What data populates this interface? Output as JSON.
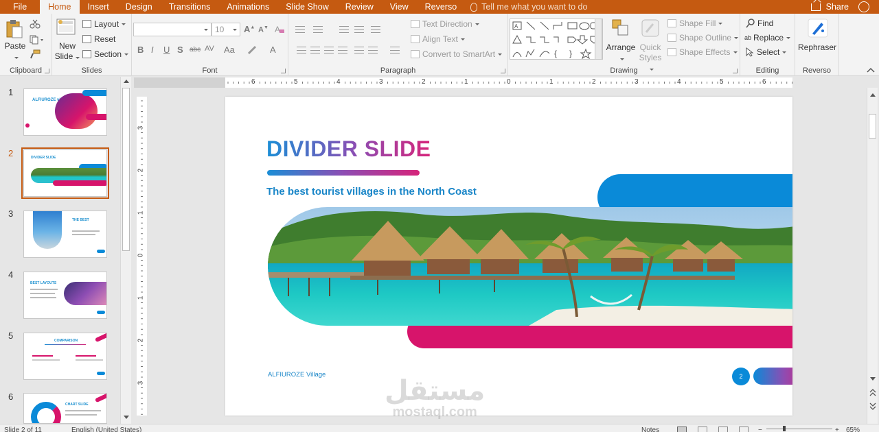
{
  "tabs": [
    "File",
    "Home",
    "Insert",
    "Design",
    "Transitions",
    "Animations",
    "Slide Show",
    "Review",
    "View",
    "Reverso"
  ],
  "active_tab": "Home",
  "tell_me": "Tell me what you want to do",
  "share": "Share",
  "ribbon": {
    "clipboard": {
      "paste": "Paste",
      "label": "Clipboard"
    },
    "slides": {
      "new_slide": "New Slide",
      "layout": "Layout",
      "reset": "Reset",
      "section": "Section",
      "label": "Slides"
    },
    "font": {
      "font_size": "10",
      "label": "Font"
    },
    "paragraph": {
      "text_direction": "Text Direction",
      "align_text": "Align Text",
      "convert_smartart": "Convert to SmartArt",
      "label": "Paragraph"
    },
    "drawing": {
      "arrange": "Arrange",
      "quick_styles": "Quick Styles",
      "shape_fill": "Shape Fill",
      "shape_outline": "Shape Outline",
      "shape_effects": "Shape Effects",
      "label": "Drawing"
    },
    "editing": {
      "find": "Find",
      "replace": "Replace",
      "select": "Select",
      "label": "Editing"
    },
    "reverso": {
      "rephraser": "Rephraser",
      "label": "Reverso"
    }
  },
  "thumbnails": [
    {
      "num": "1",
      "title": "ALFIUROZE village"
    },
    {
      "num": "2",
      "title": "DIVIDER SLIDE"
    },
    {
      "num": "3",
      "title": "THE BEST"
    },
    {
      "num": "4",
      "title": "BEST LAYOUTS"
    },
    {
      "num": "5",
      "title": "COMPARISON"
    },
    {
      "num": "6",
      "title": "CHART SLIDE"
    }
  ],
  "active_slide": "2",
  "hruler_labels": [
    "6",
    "5",
    "4",
    "3",
    "2",
    "1",
    "0",
    "1",
    "2",
    "3",
    "4",
    "5",
    "6"
  ],
  "vruler_labels": [
    "3",
    "2",
    "1",
    "0",
    "1",
    "2",
    "3"
  ],
  "slide": {
    "title": "DIVIDER SLIDE",
    "subtitle": "The best tourist villages in the North Coast",
    "footer": "ALFIUROZE Village",
    "page_number": "2"
  },
  "watermark": {
    "arabic": "مستقل",
    "latin": "mostaql.com"
  },
  "status": {
    "slide_info": "Slide 2 of 11",
    "language": "English (United States)",
    "notes": "Notes",
    "zoom": "65%"
  },
  "colors": {
    "accent": "#c55a11",
    "slide_blue": "#0a8ad8",
    "slide_pink": "#d7146b"
  }
}
